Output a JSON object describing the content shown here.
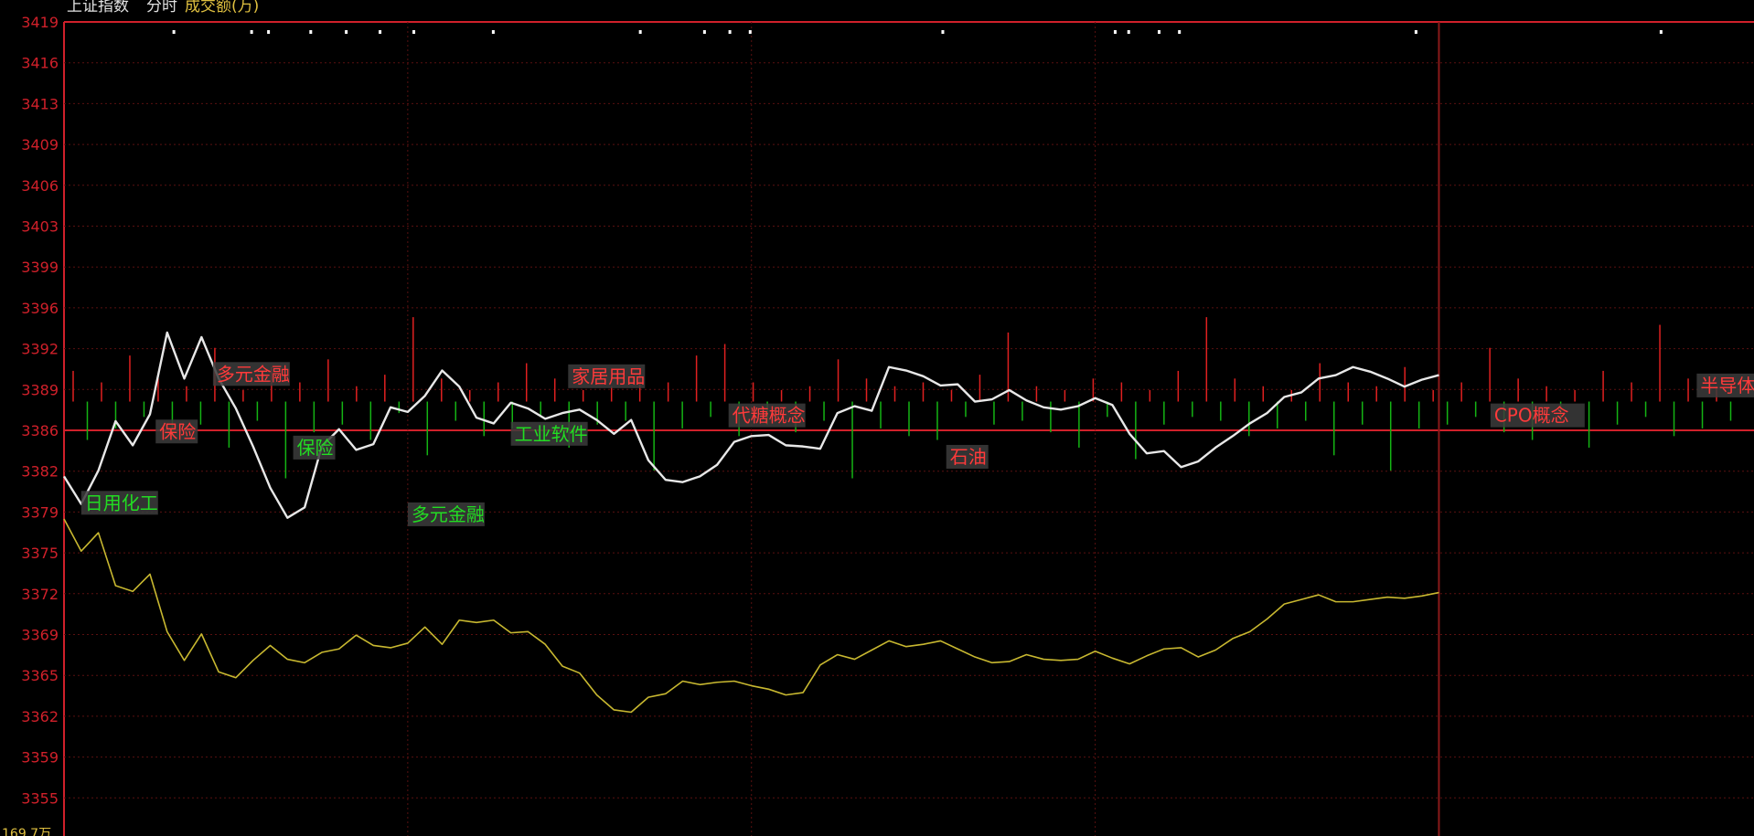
{
  "header": {
    "index_name": "上证指数",
    "mode": "分时",
    "volume_label": "成交额(万)"
  },
  "colors": {
    "background": "#000000",
    "axis_red": "#d0202a",
    "grid": "#5a1010",
    "price_line": "#e8e8e8",
    "avg_line": "#c8b830",
    "up_bar": "#e02020",
    "down_bar": "#14b414",
    "tag_bg": "#3c3c3c",
    "tag_red_text": "#ff3a3a",
    "tag_green_text": "#22dd22",
    "header_white": "#e0e0e0",
    "header_yellow": "#e0c040"
  },
  "chart_data": {
    "type": "line",
    "title": "上证指数 分时",
    "ylim": [
      3352,
      3419
    ],
    "base_price": 3386,
    "y_tick_labels": [
      "3419",
      "3416",
      "3413",
      "3409",
      "3406",
      "3403",
      "3399",
      "3396",
      "3392",
      "3389",
      "3386",
      "3382",
      "3379",
      "3375",
      "3372",
      "3369",
      "3365",
      "3362",
      "3359",
      "3355"
    ],
    "bottom_label": "169.7万",
    "grid": true,
    "series": [
      {
        "name": "price",
        "x": [
          0,
          3,
          6,
          9,
          12,
          15,
          18,
          21,
          24,
          27,
          30,
          33,
          36,
          39,
          42,
          45,
          48,
          51,
          54,
          57,
          60,
          63,
          66,
          69,
          72,
          75,
          78,
          81,
          84,
          87,
          90,
          93,
          96,
          99,
          102,
          105,
          108,
          111,
          114,
          117,
          120,
          123,
          126,
          129,
          132,
          135,
          138,
          141,
          144,
          147,
          150,
          153,
          156,
          159,
          162,
          165,
          168,
          171,
          174,
          177,
          180,
          183,
          186,
          189,
          192,
          195,
          198,
          201,
          204,
          207,
          210,
          213,
          216,
          219,
          222,
          225,
          228,
          231,
          234,
          237,
          240
        ],
        "values": [
          3379.5,
          3377.1,
          3380.0,
          3384.3,
          3382.2,
          3384.9,
          3392.0,
          3388.0,
          3391.6,
          3388.0,
          3385.4,
          3382.1,
          3378.5,
          3375.9,
          3376.8,
          3382.1,
          3383.6,
          3381.8,
          3382.3,
          3385.5,
          3385.1,
          3386.5,
          3388.7,
          3387.3,
          3384.6,
          3384.1,
          3385.9,
          3385.4,
          3384.5,
          3385.0,
          3385.3,
          3384.4,
          3383.2,
          3384.4,
          3380.9,
          3379.2,
          3379.0,
          3379.5,
          3380.5,
          3382.5,
          3383.0,
          3383.1,
          3382.2,
          3382.1,
          3381.9,
          3385.0,
          3385.6,
          3385.2,
          3389.0,
          3388.7,
          3388.2,
          3387.4,
          3387.5,
          3386.0,
          3386.2,
          3387.0,
          3386.1,
          3385.5,
          3385.3,
          3385.6,
          3386.3,
          3385.7,
          3383.2,
          3381.5,
          3381.7,
          3380.3,
          3380.8,
          3382.0,
          3383.0,
          3384.1,
          3385.0,
          3386.4,
          3386.8,
          3388.0,
          3388.3,
          3389.0,
          3388.6,
          3388.0,
          3387.3,
          3387.9,
          3388.3
        ]
      },
      {
        "name": "average",
        "x": [
          0,
          3,
          6,
          9,
          12,
          15,
          18,
          21,
          24,
          27,
          30,
          33,
          36,
          39,
          42,
          45,
          48,
          51,
          54,
          57,
          60,
          63,
          66,
          69,
          72,
          75,
          78,
          81,
          84,
          87,
          90,
          93,
          96,
          99,
          102,
          105,
          108,
          111,
          114,
          117,
          120,
          123,
          126,
          129,
          132,
          135,
          138,
          141,
          144,
          147,
          150,
          153,
          156,
          159,
          162,
          165,
          168,
          171,
          174,
          177,
          180,
          183,
          186,
          189,
          192,
          195,
          198,
          201,
          204,
          207,
          210,
          213,
          216,
          219,
          222,
          225,
          228,
          231,
          234,
          237,
          240
        ],
        "values": [
          3375.8,
          3373.0,
          3374.6,
          3370.0,
          3369.5,
          3371.0,
          3366.0,
          3363.5,
          3365.8,
          3362.5,
          3362.0,
          3363.5,
          3364.8,
          3363.6,
          3363.3,
          3364.2,
          3364.5,
          3365.7,
          3364.8,
          3364.6,
          3365.0,
          3366.4,
          3364.9,
          3367.0,
          3366.8,
          3367.0,
          3365.9,
          3366.0,
          3364.9,
          3363.0,
          3362.4,
          3360.5,
          3359.2,
          3359.0,
          3360.3,
          3360.6,
          3361.7,
          3361.4,
          3361.6,
          3361.7,
          3361.3,
          3361.0,
          3360.5,
          3360.7,
          3363.1,
          3364.0,
          3363.6,
          3364.4,
          3365.2,
          3364.7,
          3364.9,
          3365.2,
          3364.5,
          3363.8,
          3363.3,
          3363.4,
          3364.0,
          3363.6,
          3363.5,
          3363.6,
          3364.3,
          3363.7,
          3363.2,
          3363.9,
          3364.5,
          3364.6,
          3363.8,
          3364.4,
          3365.4,
          3366.0,
          3367.1,
          3368.4,
          3368.8,
          3369.2,
          3368.6,
          3368.6,
          3368.8,
          3369.0,
          3368.9,
          3369.1,
          3369.4
        ]
      }
    ],
    "volume_bars": [
      8,
      -10,
      5,
      -7,
      12,
      -4,
      6,
      -9,
      4,
      -6,
      14,
      -12,
      3,
      -5,
      9,
      -20,
      5,
      -8,
      11,
      -6,
      4,
      -10,
      7,
      -3,
      22,
      -14,
      6,
      -5,
      3,
      -9,
      5,
      -7,
      10,
      -4,
      6,
      -12,
      3,
      -6,
      4,
      -5,
      8,
      -18,
      5,
      -7,
      12,
      -4,
      15,
      -9,
      5,
      -6,
      3,
      -8,
      4,
      -5,
      11,
      -20,
      6,
      -7,
      4,
      -9,
      5,
      -10,
      3,
      -4,
      7,
      -6,
      18,
      -5,
      4,
      -8,
      3,
      -12,
      6,
      -4,
      5,
      -15,
      3,
      -6,
      8,
      -4,
      22,
      -5,
      6,
      -9,
      4,
      -7,
      3,
      -5,
      10,
      -14,
      5,
      -6,
      4,
      -18,
      9,
      -7,
      3,
      -6,
      5,
      -4,
      14,
      -8,
      6,
      -10,
      4,
      -5,
      3,
      -12,
      8,
      -6,
      5,
      -4,
      20,
      -9,
      6,
      -7,
      4,
      -5
    ],
    "top_markers": [
      0.065,
      0.111,
      0.121,
      0.146,
      0.167,
      0.187,
      0.207,
      0.254,
      0.341,
      0.379,
      0.394,
      0.406,
      0.52,
      0.622,
      0.63,
      0.648,
      0.66,
      0.8,
      0.945
    ],
    "vertical_lines": [
      {
        "x": 60,
        "style": "dotted"
      },
      {
        "x": 120,
        "style": "dotted"
      },
      {
        "x": 180,
        "style": "dotted"
      },
      {
        "x": 240,
        "style": "solid"
      }
    ],
    "annotations": [
      {
        "label": "日用化工",
        "x": 3,
        "y": 3377.2,
        "color": "green"
      },
      {
        "label": "保险",
        "x": 16,
        "y": 3383.4,
        "color": "red"
      },
      {
        "label": "多元金融",
        "x": 26,
        "y": 3388.4,
        "color": "red"
      },
      {
        "label": "保险",
        "x": 40,
        "y": 3382.0,
        "color": "green"
      },
      {
        "label": "多元金融",
        "x": 60,
        "y": 3376.2,
        "color": "green"
      },
      {
        "label": "工业软件",
        "x": 78,
        "y": 3383.2,
        "color": "green"
      },
      {
        "label": "家居用品",
        "x": 88,
        "y": 3388.2,
        "color": "red"
      },
      {
        "label": "代糖概念",
        "x": 116,
        "y": 3384.8,
        "color": "red"
      },
      {
        "label": "石油",
        "x": 154,
        "y": 3381.2,
        "color": "red"
      },
      {
        "label": "CPO概念",
        "x": 249,
        "y": 3384.8,
        "color": "red"
      },
      {
        "label": "半导体",
        "x": 285,
        "y": 3387.4,
        "color": "red"
      }
    ]
  }
}
